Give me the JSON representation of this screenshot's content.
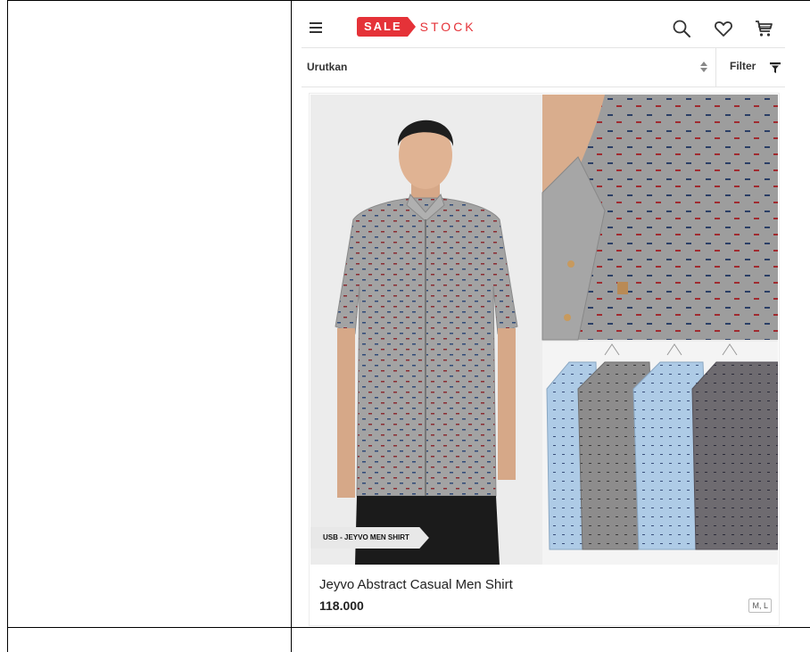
{
  "header": {
    "logo_sale": "SALE",
    "logo_stock": "STOCK"
  },
  "icons": {
    "menu": "hamburger-icon",
    "search": "search-icon",
    "wishlist": "heart-icon",
    "cart": "cart-icon",
    "sort": "sort-arrows-icon",
    "filter": "filter-icon"
  },
  "toolbar": {
    "sort_label": "Urutkan",
    "sort_arrows": "▲▼",
    "filter_label": "Filter"
  },
  "product": {
    "badge": "USB - JEYVO MEN SHIRT",
    "name": "Jeyvo Abstract Casual Men Shirt",
    "price": "118.000",
    "sizes": "M, L"
  },
  "colors": {
    "brand": "#e53238",
    "shirt_gray": "#9b9b9b",
    "shirt_blue": "#a9c6e2",
    "shirt_dark": "#6f6c72"
  }
}
